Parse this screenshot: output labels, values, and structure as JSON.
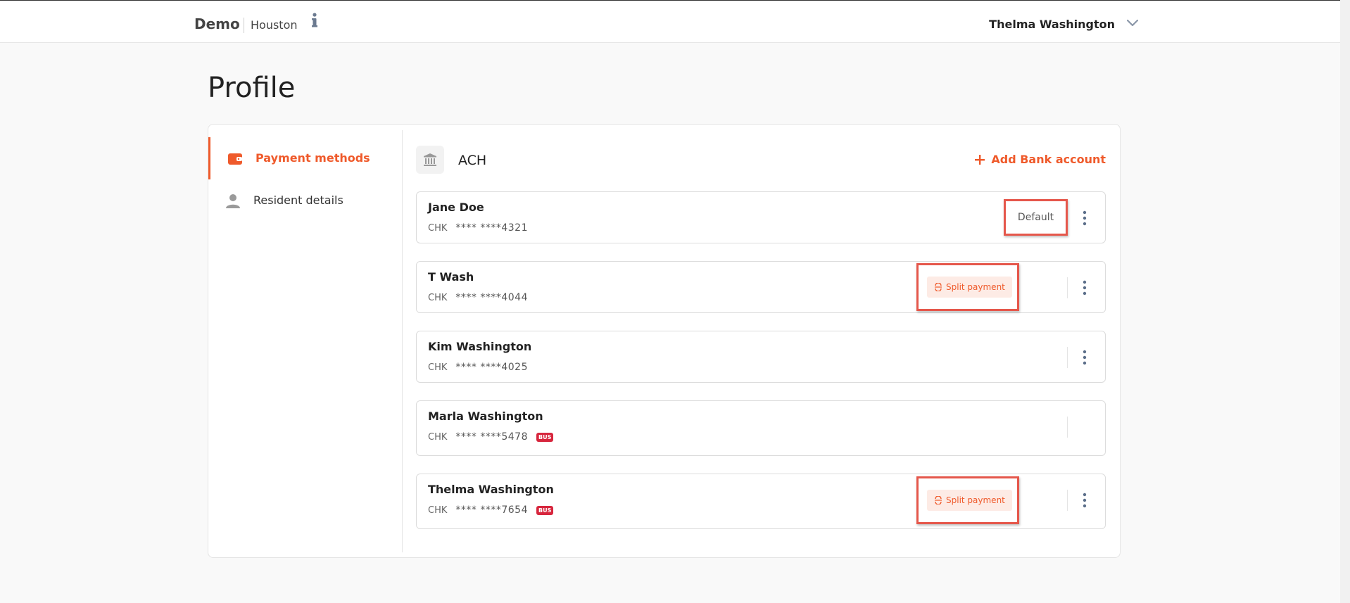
{
  "header": {
    "brand": "Demo",
    "city": "Houston",
    "user_name": "Thelma Washington"
  },
  "page": {
    "title": "Profile"
  },
  "sidebar": {
    "items": [
      {
        "label": "Payment methods",
        "active": true
      },
      {
        "label": "Resident details",
        "active": false
      }
    ]
  },
  "ach": {
    "title": "ACH",
    "add_label": "Add Bank account",
    "accounts": [
      {
        "name": "Jane Doe",
        "type": "CHK",
        "masked": "**** ****4321",
        "badge": "Default"
      },
      {
        "name": "T Wash",
        "type": "CHK",
        "masked": "**** ****4044",
        "badge": "Split payment"
      },
      {
        "name": "Kim Washington",
        "type": "CHK",
        "masked": "**** ****4025"
      },
      {
        "name": "Marla Washington",
        "type": "CHK",
        "masked": "**** ****5478",
        "tag": "BUS"
      },
      {
        "name": "Thelma Washington",
        "type": "CHK",
        "masked": "**** ****7654",
        "tag": "BUS",
        "badge": "Split payment"
      }
    ]
  },
  "colors": {
    "accent": "#ef5a2b",
    "highlight_border": "#e5574b",
    "bus_tag": "#d7263d",
    "chip_bg": "#fdebe5"
  }
}
